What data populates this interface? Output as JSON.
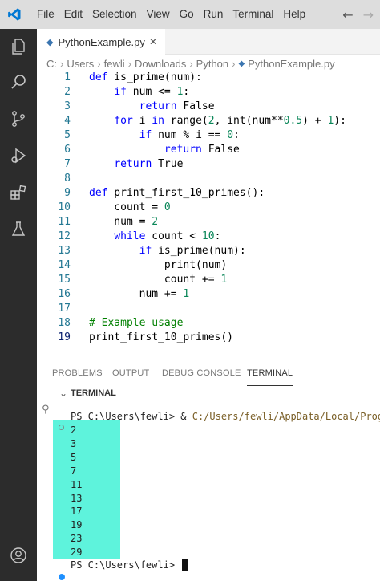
{
  "titlebar": {
    "menu": [
      "File",
      "Edit",
      "Selection",
      "View",
      "Go",
      "Run",
      "Terminal",
      "Help"
    ],
    "nav_back": "←",
    "nav_forward": "→",
    "logo_icon": "vscode-logo-icon",
    "accent": "#0078d4"
  },
  "activity_bar": {
    "icons": [
      "explorer-icon",
      "search-icon",
      "source-control-icon",
      "run-debug-icon",
      "extensions-icon",
      "testing-icon",
      "account-icon"
    ]
  },
  "tab": {
    "label": "PythonExample.py",
    "close": "✕"
  },
  "breadcrumb": [
    "C:",
    "Users",
    "fewli",
    "Downloads",
    "Python",
    "PythonExample.py"
  ],
  "code_lines": [
    {
      "n": "1",
      "html": "<span class=\"k\">def</span> is_prime(num):"
    },
    {
      "n": "2",
      "html": "    <span class=\"k\">if</span> num &lt;= <span class=\"n\">1</span>:"
    },
    {
      "n": "3",
      "html": "        <span class=\"k\">return</span> False"
    },
    {
      "n": "4",
      "html": "    <span class=\"k\">for</span> i <span class=\"k\">in</span> range(<span class=\"n\">2</span>, int(num**<span class=\"n\">0.5</span>) + <span class=\"n\">1</span>):"
    },
    {
      "n": "5",
      "html": "        <span class=\"k\">if</span> num % i == <span class=\"n\">0</span>:"
    },
    {
      "n": "6",
      "html": "            <span class=\"k\">return</span> False"
    },
    {
      "n": "7",
      "html": "    <span class=\"k\">return</span> True"
    },
    {
      "n": "8",
      "html": ""
    },
    {
      "n": "9",
      "html": "<span class=\"k\">def</span> print_first_10_primes():"
    },
    {
      "n": "10",
      "html": "    count = <span class=\"n\">0</span>"
    },
    {
      "n": "11",
      "html": "    num = <span class=\"n\">2</span>"
    },
    {
      "n": "12",
      "html": "    <span class=\"k\">while</span> count &lt; <span class=\"n\">10</span>:"
    },
    {
      "n": "13",
      "html": "        <span class=\"k\">if</span> is_prime(num):"
    },
    {
      "n": "14",
      "html": "            print(num)"
    },
    {
      "n": "15",
      "html": "            count += <span class=\"n\">1</span>"
    },
    {
      "n": "16",
      "html": "        num += <span class=\"n\">1</span>"
    },
    {
      "n": "17",
      "html": ""
    },
    {
      "n": "18",
      "html": "<span class=\"c\"># Example usage</span>"
    },
    {
      "n": "19",
      "html": "print_first_10_primes()"
    }
  ],
  "panel": {
    "tabs": [
      "PROBLEMS",
      "OUTPUT",
      "DEBUG CONSOLE",
      "TERMINAL"
    ],
    "active_tab": "TERMINAL",
    "section_header": "TERMINAL"
  },
  "terminal": {
    "prompt_1": "PS C:\\Users\\fewli> & ",
    "command_path": "C:/Users/fewli/AppData/Local/Progra",
    "output": [
      "2",
      "3",
      "5",
      "7",
      "11",
      "13",
      "17",
      "19",
      "23",
      "29"
    ],
    "prompt_2": "PS C:\\Users\\fewli> ",
    "highlight_color": "#5ef3dc"
  }
}
